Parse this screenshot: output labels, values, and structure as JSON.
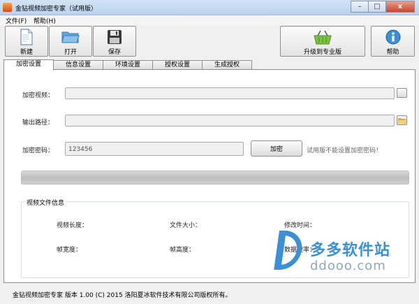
{
  "window": {
    "title": "金钻视频加密专家（试用版）",
    "minimize": "–",
    "maximize": "□",
    "close": "x"
  },
  "menu": [
    {
      "label": "文件(F)"
    },
    {
      "label": "帮助(H)"
    }
  ],
  "toolbar": {
    "new_label": "新建",
    "open_label": "打开",
    "save_label": "保存",
    "upgrade_label": "升级到专业版",
    "help_label": "帮助"
  },
  "tabs": [
    {
      "label": "加密设置",
      "active": true
    },
    {
      "label": "信息设置",
      "active": false
    },
    {
      "label": "环境设置",
      "active": false
    },
    {
      "label": "授权设置",
      "active": false
    },
    {
      "label": "生成授权",
      "active": false
    }
  ],
  "form": {
    "video_label": "加密视频：",
    "video_value": "",
    "output_label": "输出路径：",
    "output_value": "",
    "password_label": "加密密码：",
    "password_value": "123456",
    "encrypt_button": "加密",
    "trial_note": "试用版不能设置加密密码！",
    "progress": 1.0
  },
  "info_group": {
    "title": "视频文件信息",
    "video_length": "视频长度：",
    "file_size": "文件大小：",
    "modified_time": "修改时间：",
    "frame_width": "帧宽度：",
    "frame_height": "帧高度：",
    "data_rate": "数据速率："
  },
  "watermark": {
    "brand": "多多软件站",
    "site": "ddooo.com"
  },
  "status": {
    "text": "金钻视频加密专家 版本 1.00 (C) 2015 洛阳夏冰软件技术有限公司版权所有。"
  },
  "colors": {
    "progress_fill": "#3fae29",
    "accent_blue": "#3b8fd6",
    "folder": "#4f93d3",
    "basket": "#7cc242"
  }
}
